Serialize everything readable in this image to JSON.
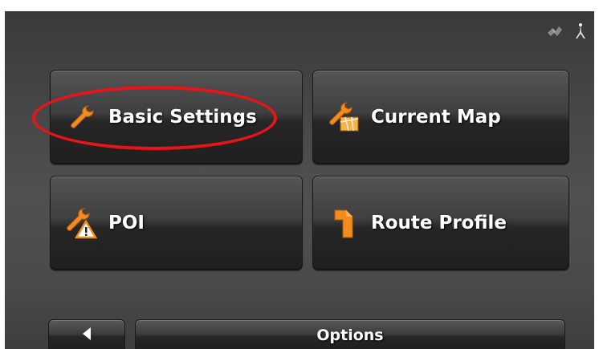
{
  "menu": {
    "basic_settings": {
      "label": "Basic Settings",
      "icon": "wrench-icon"
    },
    "current_map": {
      "label": "Current Map",
      "icon": "wrench-map-icon"
    },
    "poi": {
      "label": "POI",
      "icon": "wrench-warning-icon"
    },
    "route_profile": {
      "label": "Route Profile",
      "icon": "route-arrow-icon"
    }
  },
  "status": {
    "icons": [
      "gps-signal-icon",
      "satellite-icon"
    ]
  },
  "footer": {
    "options_label": "Options",
    "back_icon": "back-arrow-icon"
  },
  "colors": {
    "accent": "#f28c1e",
    "highlight": "#e8141a"
  }
}
